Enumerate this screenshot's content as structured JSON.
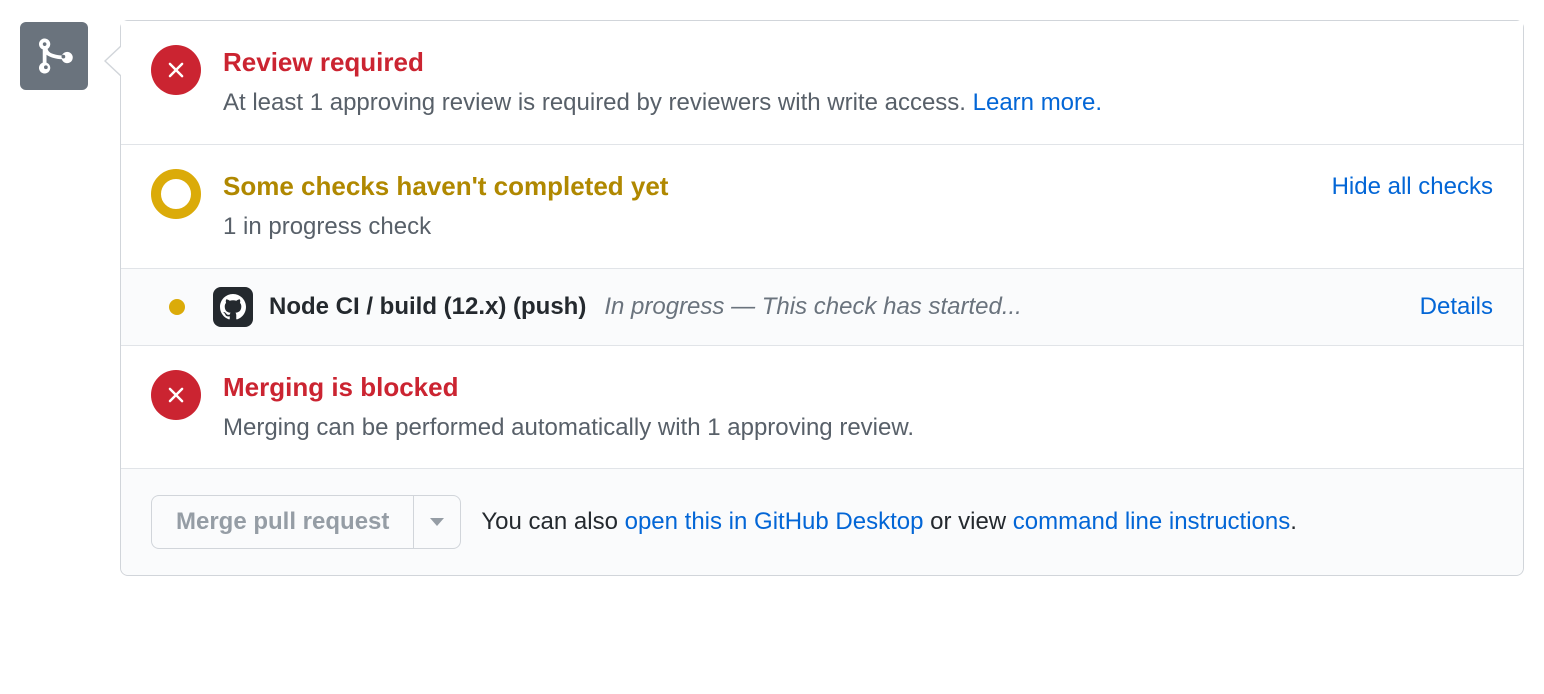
{
  "review": {
    "title": "Review required",
    "desc": "At least 1 approving review is required by reviewers with write access. ",
    "learn_more": "Learn more."
  },
  "checks": {
    "title": "Some checks haven't completed yet",
    "subtitle": "1 in progress check",
    "hide_all": "Hide all checks"
  },
  "check_item": {
    "name": "Node CI / build (12.x) (push)",
    "status": "In progress — This check has started...",
    "details": "Details"
  },
  "blocked": {
    "title": "Merging is blocked",
    "desc": "Merging can be performed automatically with 1 approving review."
  },
  "footer": {
    "merge_button": "Merge pull request",
    "prefix": "You can also ",
    "open_desktop": "open this in GitHub Desktop",
    "middle": " or view ",
    "cli": "command line instructions",
    "suffix": "."
  }
}
